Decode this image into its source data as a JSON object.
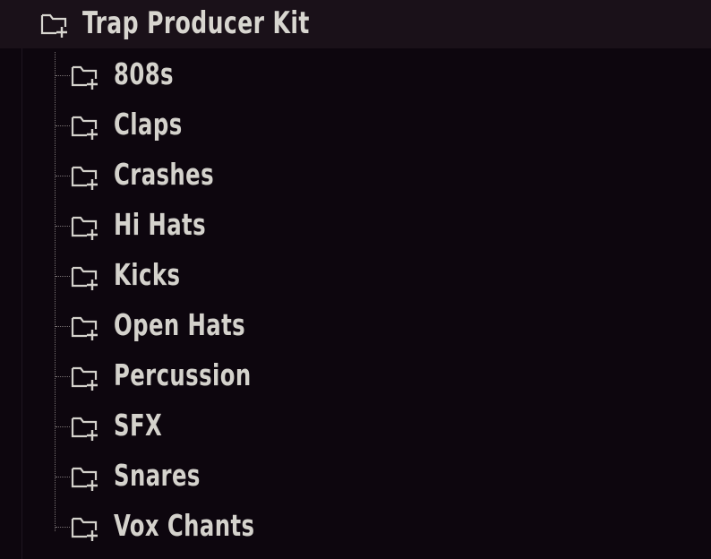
{
  "root": {
    "label": "Trap Producer Kit",
    "icon": "folder-add-icon"
  },
  "children": [
    {
      "label": "808s",
      "icon": "folder-add-icon"
    },
    {
      "label": "Claps",
      "icon": "folder-add-icon"
    },
    {
      "label": "Crashes",
      "icon": "folder-add-icon"
    },
    {
      "label": "Hi Hats",
      "icon": "folder-add-icon"
    },
    {
      "label": "Kicks",
      "icon": "folder-add-icon"
    },
    {
      "label": "Open Hats",
      "icon": "folder-add-icon"
    },
    {
      "label": "Percussion",
      "icon": "folder-add-icon"
    },
    {
      "label": "SFX",
      "icon": "folder-add-icon"
    },
    {
      "label": "Snares",
      "icon": "folder-add-icon"
    },
    {
      "label": "Vox Chants",
      "icon": "folder-add-icon"
    }
  ],
  "colors": {
    "background": "#0d060e",
    "root_row": "#1a1119",
    "text": "#d4d2cc",
    "tree_lines": "#7a7374"
  }
}
